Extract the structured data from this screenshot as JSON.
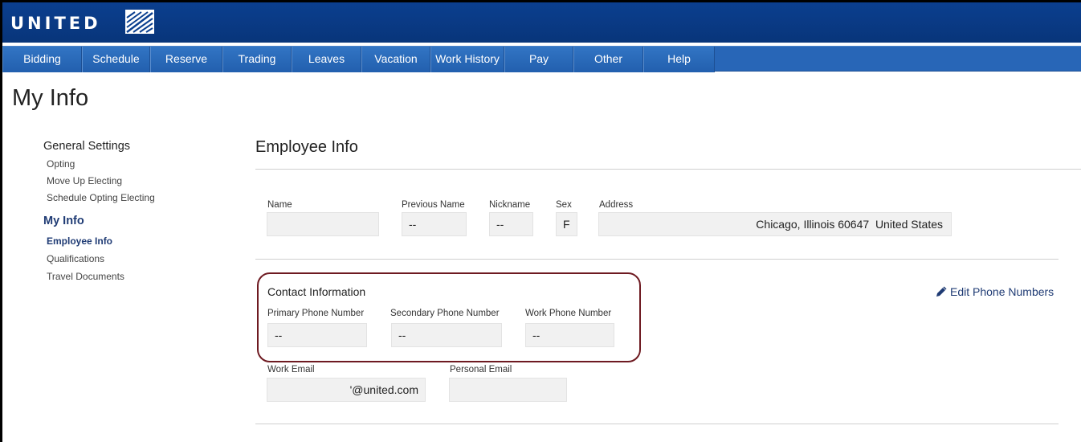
{
  "brand": {
    "logo_text": "UNITED"
  },
  "nav": {
    "items": [
      {
        "label": "Bidding"
      },
      {
        "label": "Schedule"
      },
      {
        "label": "Reserve"
      },
      {
        "label": "Trading"
      },
      {
        "label": "Leaves"
      },
      {
        "label": "Vacation"
      },
      {
        "label": "Work History"
      },
      {
        "label": "Pay"
      },
      {
        "label": "Other"
      },
      {
        "label": "Help"
      }
    ]
  },
  "page": {
    "title": "My Info"
  },
  "sidebar": {
    "general_settings": "General Settings",
    "general_items": [
      "Opting",
      "Move Up Electing",
      "Schedule Opting Electing"
    ],
    "my_info": "My Info",
    "my_info_items": [
      "Employee Info",
      "Qualifications",
      "Travel Documents"
    ]
  },
  "employee_info": {
    "title": "Employee Info",
    "name_label": "Name",
    "name_value": "",
    "previous_name_label": "Previous Name",
    "previous_name_value": "--",
    "nickname_label": "Nickname",
    "nickname_value": "--",
    "sex_label": "Sex",
    "sex_value": "F",
    "address_label": "Address",
    "address_value": "Chicago, Illinois 60647  United States"
  },
  "contact": {
    "title": "Contact Information",
    "primary_label": "Primary Phone Number",
    "primary_value": "--",
    "secondary_label": "Secondary Phone Number",
    "secondary_value": "--",
    "work_phone_label": "Work Phone Number",
    "work_phone_value": "--",
    "edit_label": "Edit Phone Numbers",
    "work_email_label": "Work Email",
    "work_email_value": "'@united.com",
    "personal_email_label": "Personal Email",
    "personal_email_value": ""
  },
  "colors": {
    "topbar": "#08357a",
    "navbar": "#2866b7",
    "link": "#1f3b74",
    "highlight_frame": "#6e1a21"
  }
}
